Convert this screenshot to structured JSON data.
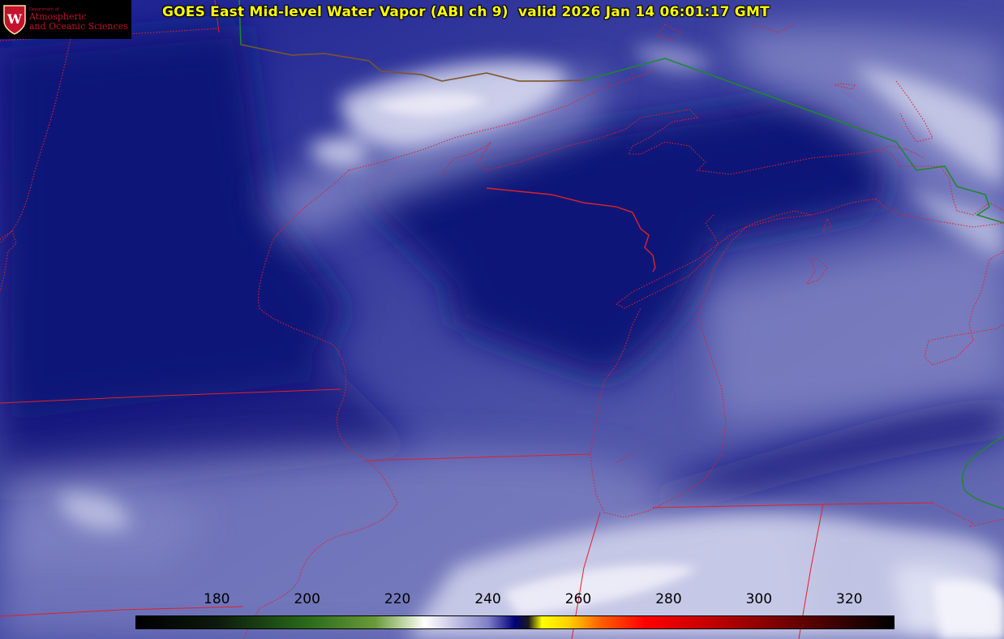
{
  "title": "GOES East Mid-level Water Vapor (ABI ch 9)  valid 2026 Jan 14 06:01:17 GMT",
  "logo": {
    "icon": "uw-crest-icon",
    "line0": "Department of",
    "line1": "Atmospheric",
    "line2": "and Oceanic Sciences",
    "color": "#c5102e"
  },
  "colorbar": {
    "ticks": [
      "180",
      "200",
      "220",
      "240",
      "260",
      "280",
      "300",
      "320"
    ],
    "range": [
      162,
      330
    ],
    "stops": [
      {
        "value": 162,
        "color": "#000000"
      },
      {
        "value": 180,
        "color": "#0c1a0c"
      },
      {
        "value": 200,
        "color": "#2a6a1a"
      },
      {
        "value": 215,
        "color": "#6a9a3a"
      },
      {
        "value": 222,
        "color": "#c8dcb0"
      },
      {
        "value": 226,
        "color": "#ffffff"
      },
      {
        "value": 240,
        "color": "#8080c8"
      },
      {
        "value": 246,
        "color": "#00007a"
      },
      {
        "value": 249,
        "color": "#1a1a1a"
      },
      {
        "value": 252,
        "color": "#ffff00"
      },
      {
        "value": 258,
        "color": "#ffd000"
      },
      {
        "value": 265,
        "color": "#ff6000"
      },
      {
        "value": 275,
        "color": "#ff0000"
      },
      {
        "value": 290,
        "color": "#c00000"
      },
      {
        "value": 310,
        "color": "#600000"
      },
      {
        "value": 330,
        "color": "#000000"
      }
    ]
  },
  "map": {
    "state_border_color": "#e0202a",
    "country_border_color": "#1a8a2a",
    "vapor_dark_color": "#0f1478",
    "vapor_mid_color": "#5a60b0",
    "vapor_light_color": "#d8dcf0"
  }
}
